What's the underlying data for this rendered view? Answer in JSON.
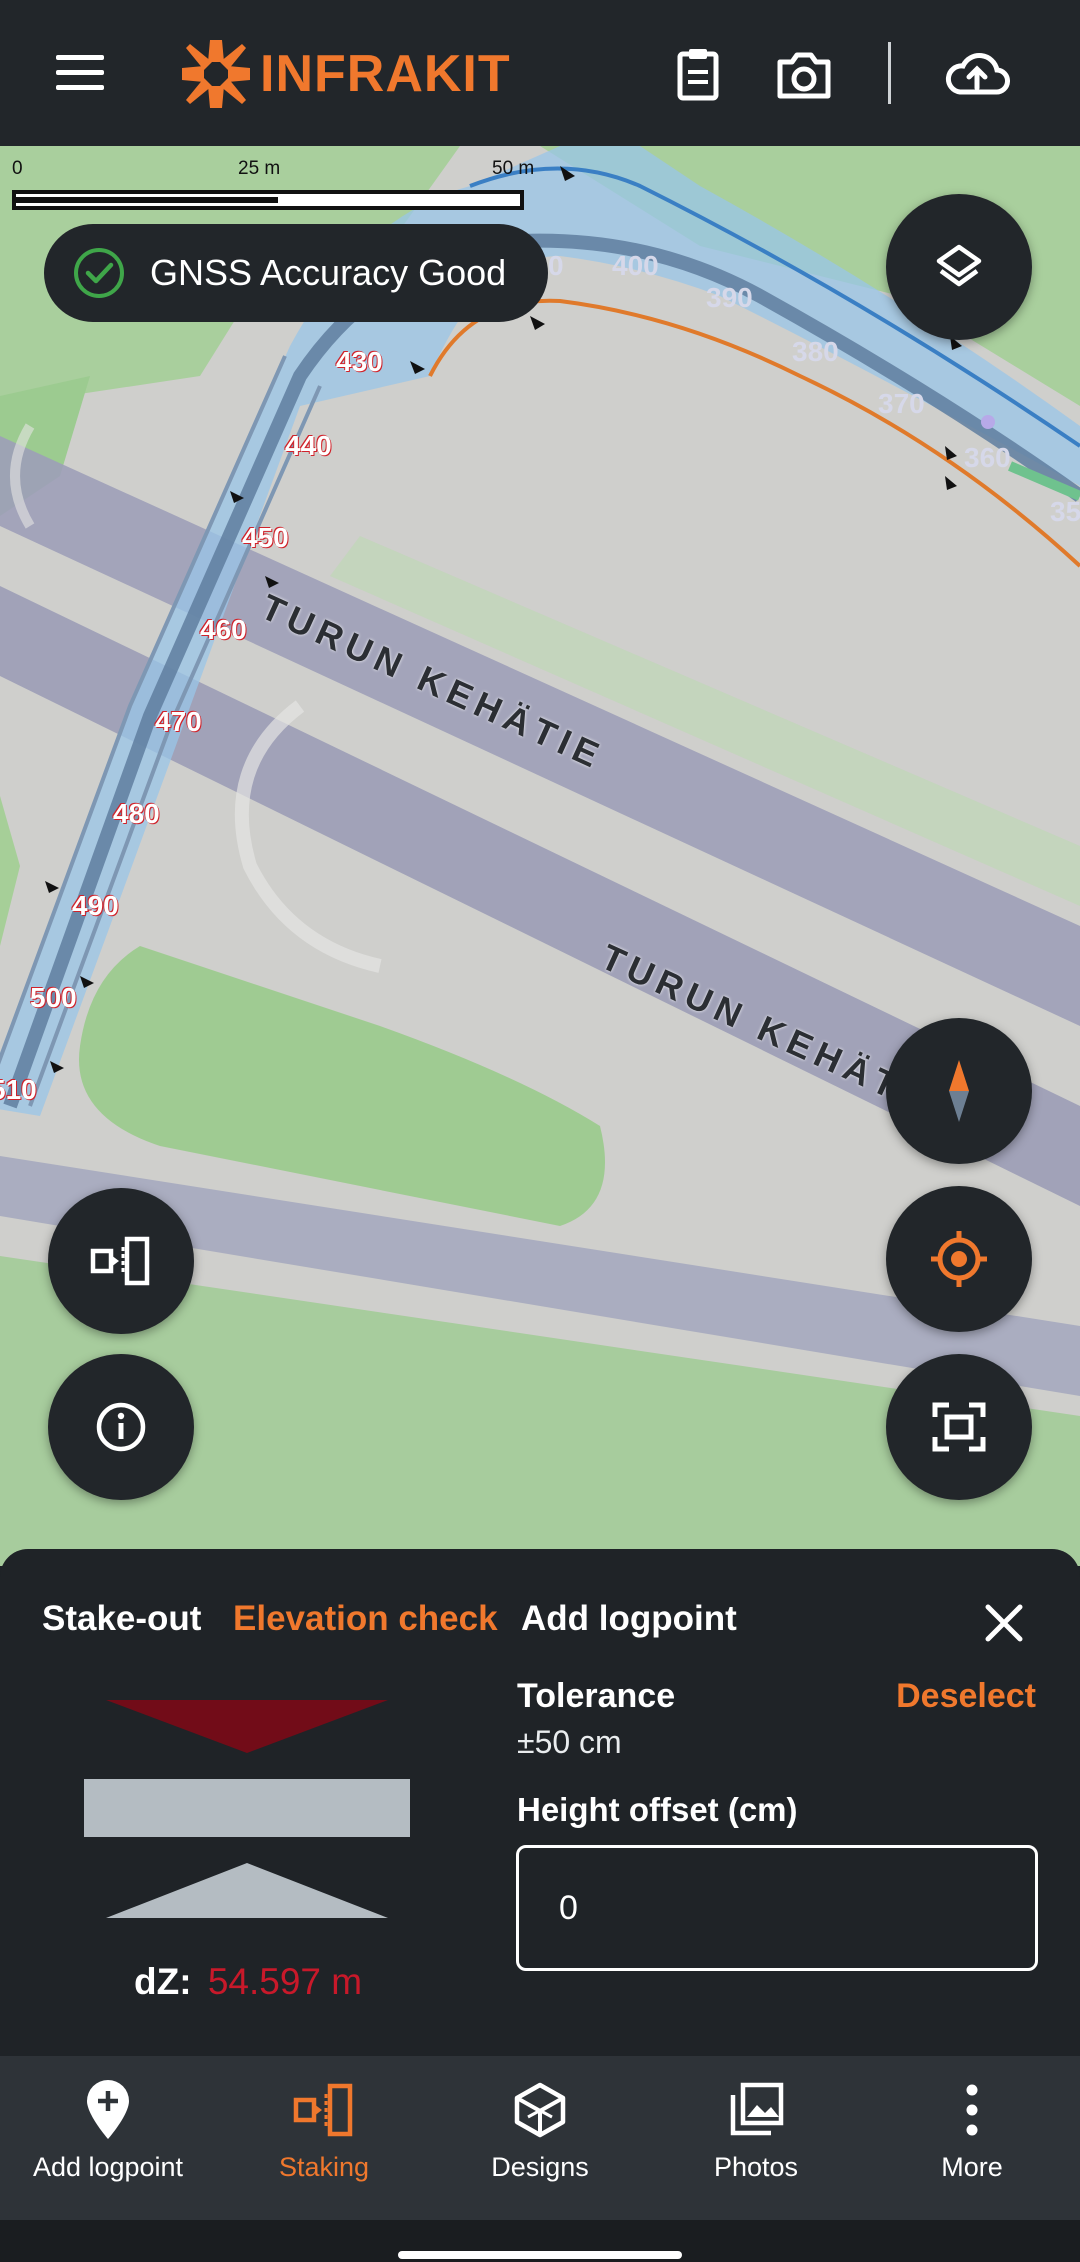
{
  "header": {
    "menu_icon": "hamburger-menu-icon",
    "brand": "INFRAKIT",
    "icons": [
      "clipboard-icon",
      "camera-icon",
      "cloud-upload-icon"
    ]
  },
  "map": {
    "scale": {
      "labels": [
        "0",
        "25 m",
        "50 m"
      ]
    },
    "gnss_status": "GNSS Accuracy Good",
    "road_labels": [
      "TURUN KEHÄTIE",
      "TURUN KEHÄT"
    ],
    "stations_upper": [
      "0",
      "400",
      "390",
      "380",
      "370",
      "360",
      "35"
    ],
    "stations_left": [
      "430",
      "440",
      "450",
      "460",
      "470",
      "480",
      "490",
      "500",
      "510"
    ],
    "buttons": [
      "layers-icon",
      "compass-icon",
      "my-location-icon",
      "fit-extent-icon",
      "staking-mode-icon",
      "info-icon"
    ]
  },
  "sheet": {
    "tabs": [
      "Stake-out",
      "Elevation check",
      "Add logpoint"
    ],
    "active_tab": "Elevation check",
    "tolerance_label": "Tolerance",
    "tolerance_value": "±50 cm",
    "deselect_label": "Deselect",
    "height_offset_label": "Height offset (cm)",
    "height_offset_value": "0",
    "dz_label": "dZ:",
    "dz_value": "54.597 m"
  },
  "nav": {
    "items": [
      {
        "label": "Add logpoint",
        "icon": "add-logpoint-icon"
      },
      {
        "label": "Staking",
        "icon": "staking-icon"
      },
      {
        "label": "Designs",
        "icon": "designs-icon"
      },
      {
        "label": "Photos",
        "icon": "photos-icon"
      },
      {
        "label": "More",
        "icon": "more-vertical-icon"
      }
    ],
    "active": "Staking"
  },
  "colors": {
    "accent": "#f0782d",
    "background": "#1f2327",
    "error": "#c8192a"
  }
}
